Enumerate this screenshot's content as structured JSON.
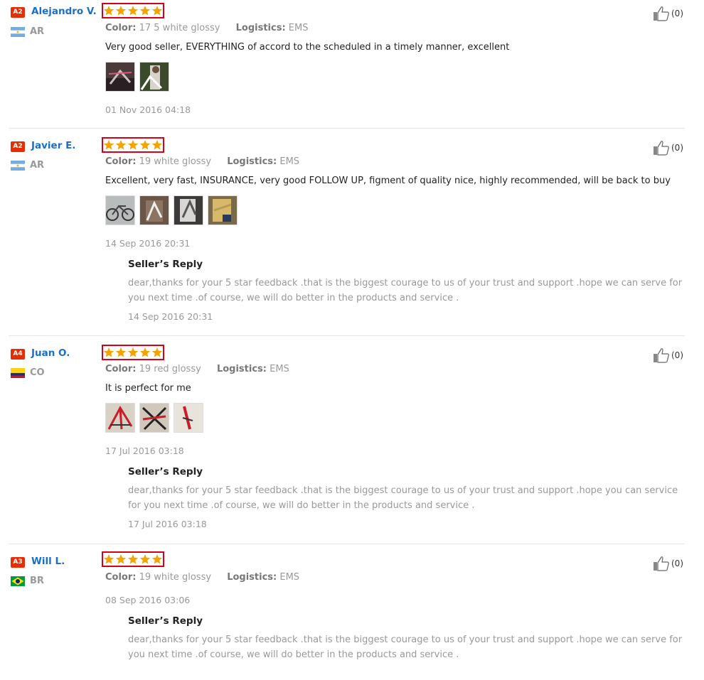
{
  "icons": {
    "like": "thumbs-up-icon",
    "star": "star-icon"
  },
  "colors": {
    "accent_star": "#f5a300",
    "badge_red": "#e62e04",
    "name_blue": "#1a6fc9",
    "stars_border": "#d6001c"
  },
  "labels": {
    "color": "Color:",
    "logistics": "Logistics:",
    "seller_reply": "Seller’s Reply"
  },
  "reviews": [
    {
      "badge": "A2",
      "name": "Alejandro V.",
      "country": "AR",
      "flag": "argentina-flag",
      "rating": 5,
      "color_value": "17 5 white glossy",
      "logistics_value": "EMS",
      "text": "Very good seller, EVERYTHING of accord to the scheduled in a timely manner, excellent",
      "images": [
        "bike-frame-photo",
        "bike-frame-photo"
      ],
      "date": "01 Nov 2016 04:18",
      "likes": "(0)"
    },
    {
      "badge": "A2",
      "name": "Javier E.",
      "country": "AR",
      "flag": "argentina-flag",
      "rating": 5,
      "color_value": "19 white glossy",
      "logistics_value": "EMS",
      "text": "Excellent, very fast, INSURANCE, very good FOLLOW UP, figment of quality nice, highly recommended, will be back to buy",
      "images": [
        "bike-photo",
        "bike-frame-photo",
        "bike-frame-photo",
        "package-photo"
      ],
      "date": "14 Sep 2016 20:31",
      "likes": "(0)",
      "reply": {
        "text": "dear,thanks for your 5 star feedback .that is the biggest courage to us of your trust and support .hope we can serve for you next time .of course, we will do better in the products and service .",
        "date": "14 Sep 2016 20:31"
      }
    },
    {
      "badge": "A4",
      "name": "Juan O.",
      "country": "CO",
      "flag": "colombia-flag",
      "rating": 5,
      "color_value": "19 red glossy",
      "logistics_value": "EMS",
      "text": "It is perfect for me",
      "images": [
        "bike-frame-photo",
        "bike-frame-photo",
        "bike-frame-photo"
      ],
      "date": "17 Jul 2016 03:18",
      "likes": "(0)",
      "reply": {
        "text": "dear,thanks for your 5 star feedback .that is the biggest courage to us of your trust and support .hope you can service for you next time .of course, we will do better in the products and service .",
        "date": "17 Jul 2016 03:18"
      }
    },
    {
      "badge": "A3",
      "name": "Will L.",
      "country": "BR",
      "flag": "brazil-flag",
      "rating": 5,
      "color_value": "19 white glossy",
      "logistics_value": "EMS",
      "date": "08 Sep 2016 03:06",
      "likes": "(0)",
      "reply": {
        "text": "dear,thanks for your 5 star feedback .that is the biggest courage to us of your trust and support .hope we can serve for you next time .of course, we will do better in the products and service ."
      }
    }
  ]
}
